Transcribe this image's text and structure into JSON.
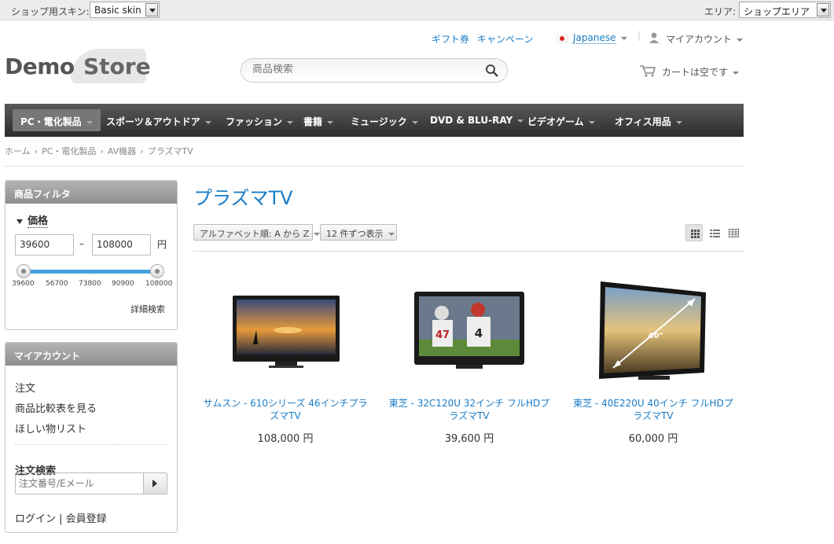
{
  "topbar": {
    "skin_label": "ショップ用スキン:",
    "skin_value": "Basic skin",
    "area_label": "エリア:",
    "area_value": "ショップエリア"
  },
  "header": {
    "links": [
      "ギフト券",
      "キャンペーン"
    ],
    "language": "Japanese",
    "account": "マイアカウント",
    "cart": "カートは空です",
    "search_placeholder": "商品検索",
    "logo_left": "Demo",
    "logo_right": "Store"
  },
  "nav": {
    "items": [
      "PC・電化製品",
      "スポーツ＆アウトドア",
      "ファッション",
      "書籍",
      "ミュージック",
      "DVD & BLU-RAY",
      "ビデオゲーム",
      "オフィス用品"
    ]
  },
  "breadcrumb": [
    "ホーム",
    "PC・電化製品",
    "AV機器",
    "プラズマTV"
  ],
  "filter": {
    "title": "商品フィルタ",
    "price_label": "価格",
    "min": "39600",
    "max": "108000",
    "dash": "–",
    "currency": "円",
    "ticks": [
      "39600",
      "56700",
      "73800",
      "90900",
      "108000"
    ],
    "advanced": "詳細検索"
  },
  "account_box": {
    "title": "マイアカウント",
    "links": [
      "注文",
      "商品比較表を見る",
      "ほしい物リスト"
    ],
    "order_search_label": "注文検索",
    "order_placeholder": "注文番号/Eメール",
    "login": "ログイン | 会員登録"
  },
  "main": {
    "title": "プラズマTV",
    "sort": "アルファベット順: A から Z",
    "per_page": "12 件ずつ表示"
  },
  "products": [
    {
      "name": "サムスン - 610シリーズ 46インチプラズマTV",
      "price": "108,000 円"
    },
    {
      "name": "東芝 - 32C120U 32インチ フルHDプラズマTV",
      "price": "39,600 円"
    },
    {
      "name": "東芝 - 40E220U 40インチ フルHDプラズマTV",
      "price": "60,000 円",
      "badge": "40\""
    }
  ]
}
